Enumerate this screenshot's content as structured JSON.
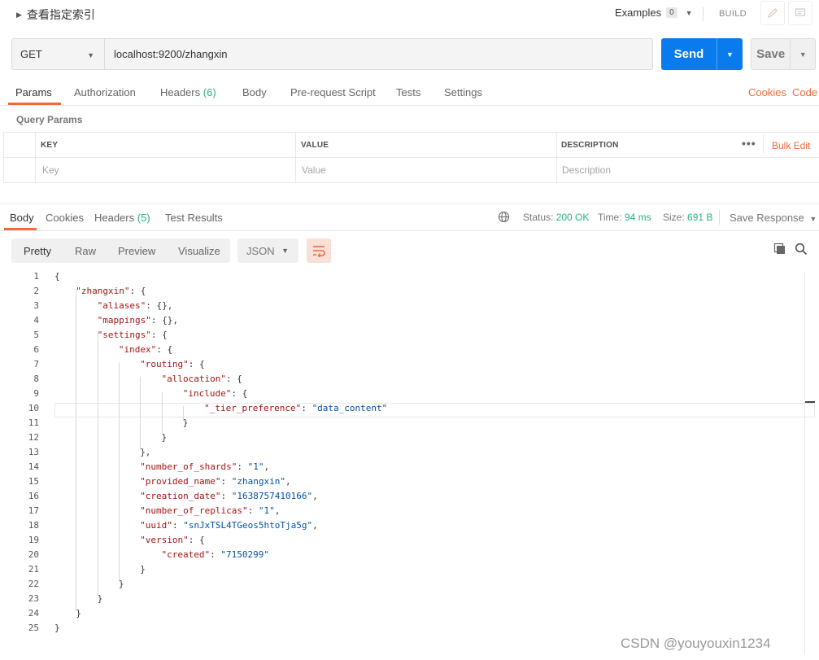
{
  "header": {
    "request_name": "查看指定索引",
    "examples_label": "Examples",
    "examples_count": "0",
    "build_label": "BUILD"
  },
  "request": {
    "method": "GET",
    "url": "localhost:9200/zhangxin",
    "send_label": "Send",
    "save_label": "Save"
  },
  "request_tabs": {
    "params": "Params",
    "authorization": "Authorization",
    "headers": "Headers",
    "headers_count": "(6)",
    "body": "Body",
    "prerequest": "Pre-request Script",
    "tests": "Tests",
    "settings": "Settings",
    "cookies": "Cookies",
    "code": "Code"
  },
  "query_params": {
    "title": "Query Params",
    "col_key": "KEY",
    "col_value": "VALUE",
    "col_description": "DESCRIPTION",
    "bulk_edit": "Bulk Edit",
    "key_placeholder": "Key",
    "value_placeholder": "Value",
    "description_placeholder": "Description"
  },
  "response_tabs": {
    "body": "Body",
    "cookies": "Cookies",
    "headers": "Headers",
    "headers_count": "(5)",
    "test_results": "Test Results"
  },
  "response_status": {
    "status_label": "Status:",
    "status_value": "200 OK",
    "time_label": "Time:",
    "time_value": "94 ms",
    "size_label": "Size:",
    "size_value": "691 B",
    "save_response": "Save Response"
  },
  "format_bar": {
    "pretty": "Pretty",
    "raw": "Raw",
    "preview": "Preview",
    "visualize": "Visualize",
    "language": "JSON"
  },
  "code_lines": [
    "{",
    "\"zhangxin\": {",
    "\"aliases\": {},",
    "\"mappings\": {},",
    "\"settings\": {",
    "\"index\": {",
    "\"routing\": {",
    "\"allocation\": {",
    "\"include\": {",
    "\"_tier_preference\": \"data_content\"",
    "}",
    "}",
    "},",
    "\"number_of_shards\": \"1\",",
    "\"provided_name\": \"zhangxin\",",
    "\"creation_date\": \"1638757410166\",",
    "\"number_of_replicas\": \"1\",",
    "\"uuid\": \"snJxTSL4TGeos5htoTja5g\",",
    "\"version\": {",
    "\"created\": \"7150299\"",
    "}",
    "}",
    "}",
    "}",
    "}"
  ],
  "watermark": "CSDN @youyouxin1234"
}
